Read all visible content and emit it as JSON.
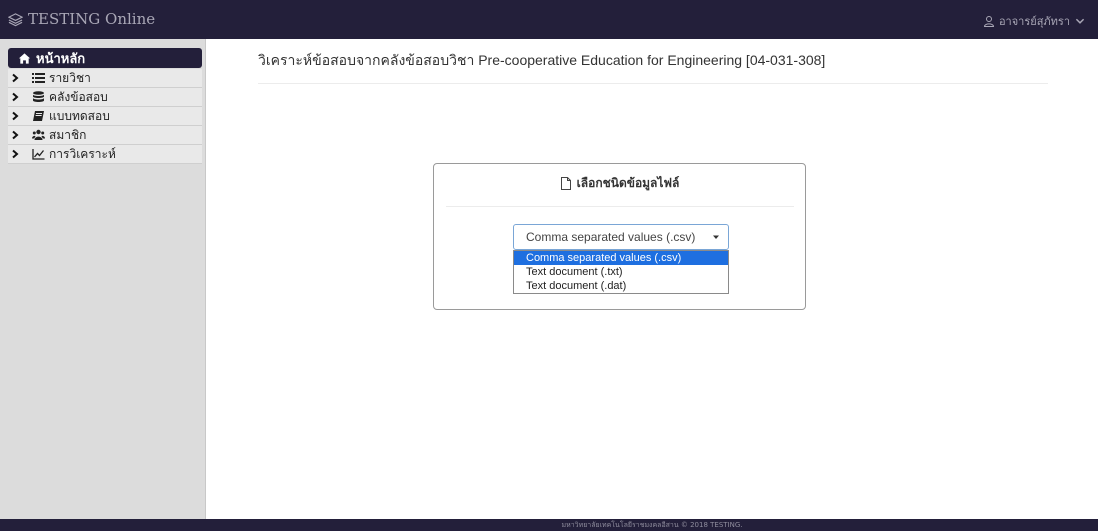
{
  "navbar": {
    "brand": "TESTING Online",
    "brand_icon": "layers-icon",
    "user": "อาจารย์สุภัทรา",
    "user_icon": "user-icon"
  },
  "sidebar": {
    "home_label": "หน้าหลัก",
    "items": [
      {
        "label": "รายวิชา",
        "icon": "list-icon"
      },
      {
        "label": "คลังข้อสอบ",
        "icon": "database-icon"
      },
      {
        "label": "แบบทดสอบ",
        "icon": "book-icon"
      },
      {
        "label": "สมาชิก",
        "icon": "users-icon"
      },
      {
        "label": "การวิเคราะห์",
        "icon": "chart-line-icon"
      }
    ]
  },
  "main": {
    "title": "วิเคราะห์ข้อสอบจากคลังข้อสอบวิชา Pre-cooperative Education for Engineering [04-031-308]",
    "panel_heading": "เลือกชนิดข้อมูลไฟล์",
    "select": {
      "value": "Comma separated values (.csv)",
      "options": [
        "Comma separated values (.csv)",
        "Text document (.txt)",
        "Text document (.dat)"
      ],
      "highlighted_index": 0
    }
  },
  "footer": {
    "text": "มหาวิทยาลัยเทคโนโลยีราชมงคลอีสาน © 2018 TESTING."
  },
  "colors": {
    "navbar_bg": "#231f3a",
    "highlight": "#1e6fe0"
  }
}
